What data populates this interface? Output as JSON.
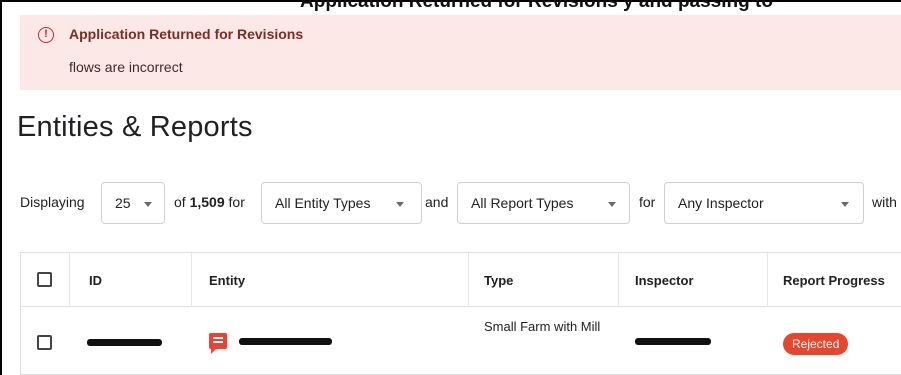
{
  "top_banner_text": "Application Returned for Revisions          y and passing to",
  "alert": {
    "icon": "alert-circle-icon",
    "title": "Application Returned for Revisions",
    "message": "flows are incorrect",
    "background": "#fce8e6",
    "icon_color": "#c62828"
  },
  "page_title": "Entities & Reports",
  "filters": {
    "displaying_label": "Displaying",
    "page_size": "25",
    "of_label": "of",
    "total_count": "1,509",
    "for_label_1": "for",
    "entity_type": "All Entity Types",
    "and_label": "and",
    "report_type": "All Report Types",
    "for_label_2": "for",
    "inspector": "Any Inspector",
    "trailing_text": "with"
  },
  "table": {
    "headers": {
      "id": "ID",
      "entity": "Entity",
      "type": "Type",
      "inspector": "Inspector",
      "progress": "Report Progress"
    },
    "rows": [
      {
        "type": "Small Farm with Mill",
        "status": "Rejected",
        "entity_icon": "comment-icon",
        "status_color": "#e8462c"
      }
    ]
  }
}
